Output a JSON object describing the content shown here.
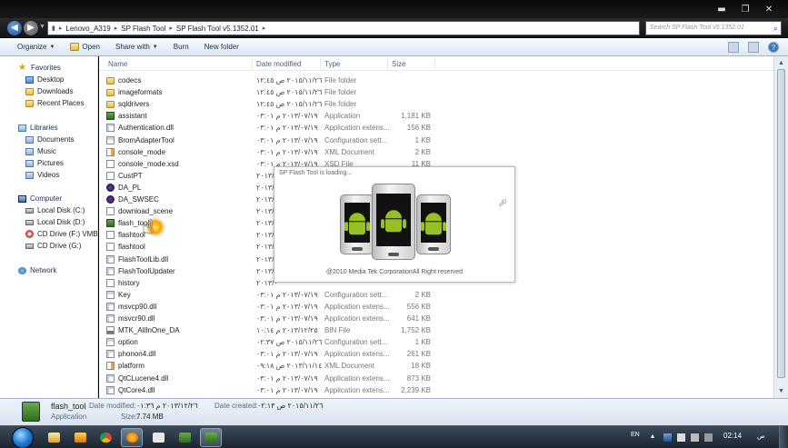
{
  "window": {
    "controls": {
      "minimize": "▬",
      "maximize": "❐",
      "close": "✕"
    }
  },
  "address": {
    "crumbs": [
      "Lenovo_A319",
      "SP Flash Tool",
      "SP Flash Tool v5.1352.01"
    ],
    "search_placeholder": "Search SP Flash Tool v5.1352.01"
  },
  "toolbar": {
    "organize": "Organize",
    "open": "Open",
    "share_with": "Share with",
    "burn": "Burn",
    "new_folder": "New folder"
  },
  "nav": {
    "favorites": {
      "label": "Favorites",
      "items": [
        "Desktop",
        "Downloads",
        "Recent Places"
      ]
    },
    "libraries": {
      "label": "Libraries",
      "items": [
        "Documents",
        "Music",
        "Pictures",
        "Videos"
      ]
    },
    "computer": {
      "label": "Computer",
      "items": [
        "Local Disk (C:)",
        "Local Disk (D:)",
        "CD Drive (F:) VMB Lite",
        "CD Drive (G:)"
      ]
    },
    "network": {
      "label": "Network"
    }
  },
  "columns": {
    "name": "Name",
    "date": "Date modified",
    "type": "Type",
    "size": "Size"
  },
  "files": [
    {
      "name": "codecs",
      "date": "٢٠١٥/١١/٢٦ ص ١٢:٤٥",
      "type": "File folder",
      "size": "",
      "icon": "folder"
    },
    {
      "name": "imageformats",
      "date": "٢٠١٥/١١/٢٦ ص ١٢:٤٥",
      "type": "File folder",
      "size": "",
      "icon": "folder"
    },
    {
      "name": "sqldrivers",
      "date": "٢٠١٥/١١/٢٦ ص ١٢:٤٥",
      "type": "File folder",
      "size": "",
      "icon": "folder"
    },
    {
      "name": "assistant",
      "date": "٢٠١٣/٠٧/١٩ م ٠٣:٠١",
      "type": "Application",
      "size": "1,181 KB",
      "icon": "app"
    },
    {
      "name": "Authentication.dll",
      "date": "٢٠١٣/٠٧/١٩ م ٠٣:٠١",
      "type": "Application extens...",
      "size": "156 KB",
      "icon": "dll"
    },
    {
      "name": "BromAdapterTool",
      "date": "٢٠١٣/٠٧/١٩ م ٠٣:٠١",
      "type": "Configuration sett...",
      "size": "1 KB",
      "icon": "cfg"
    },
    {
      "name": "console_mode",
      "date": "٢٠١٣/٠٧/١٩ م ٠٣:٠١",
      "type": "XML Document",
      "size": "2 KB",
      "icon": "xml"
    },
    {
      "name": "console_mode.xsd",
      "date": "٢٠١٣/٠٧/١٩ م ٠٣:٠١",
      "type": "XSD File",
      "size": "11 KB",
      "icon": "file"
    },
    {
      "name": "CustPT",
      "date": "٢٠١٣/٠",
      "type": "",
      "size": "",
      "icon": "file"
    },
    {
      "name": "DA_PL",
      "date": "٢٠١٣/٠",
      "type": "",
      "size": "",
      "icon": "dapl"
    },
    {
      "name": "DA_SWSEC",
      "date": "٢٠١٣/٠",
      "type": "",
      "size": "",
      "icon": "dapl"
    },
    {
      "name": "download_scene",
      "date": "٢٠١٣/٠",
      "type": "",
      "size": "",
      "icon": "file"
    },
    {
      "name": "flash_tool",
      "date": "٢٠١٣/١",
      "type": "",
      "size": "",
      "icon": "app"
    },
    {
      "name": "flashtool",
      "date": "٢٠١٣/٠",
      "type": "",
      "size": "",
      "icon": "file"
    },
    {
      "name": "flashtool",
      "date": "٢٠١٣/٠",
      "type": "",
      "size": "",
      "icon": "file"
    },
    {
      "name": "FlashToolLib.dll",
      "date": "٢٠١٣/٠",
      "type": "",
      "size": "",
      "icon": "dll"
    },
    {
      "name": "FlashToolUpdater",
      "date": "٢٠١٣/٠",
      "type": "",
      "size": "",
      "icon": "dll"
    },
    {
      "name": "history",
      "date": "٢٠١٣/٠",
      "type": "",
      "size": "",
      "icon": "file"
    },
    {
      "name": "Key",
      "date": "٢٠١٣/٠٧/١٩ م ٠٣:٠١",
      "type": "Configuration sett...",
      "size": "2 KB",
      "icon": "cfg"
    },
    {
      "name": "msvcp90.dll",
      "date": "٢٠١٣/٠٧/١٩ م ٠٣:٠١",
      "type": "Application extens...",
      "size": "556 KB",
      "icon": "dll"
    },
    {
      "name": "msvcr90.dll",
      "date": "٢٠١٣/٠٧/١٩ م ٠٣:٠١",
      "type": "Application extens...",
      "size": "641 KB",
      "icon": "dll"
    },
    {
      "name": "MTK_AllInOne_DA",
      "date": "٢٠١٣/١٢/٢٥ م ١٠:١٤",
      "type": "BIN File",
      "size": "1,752 KB",
      "icon": "bin"
    },
    {
      "name": "option",
      "date": "٢٠١٥/١١/٢٦ ص ٠٢:٣٧",
      "type": "Configuration sett...",
      "size": "1 KB",
      "icon": "cfg"
    },
    {
      "name": "phonon4.dll",
      "date": "٢٠١٣/٠٧/١٩ م ٠٣:٠١",
      "type": "Application extens...",
      "size": "261 KB",
      "icon": "dll"
    },
    {
      "name": "platform",
      "date": "٢٠١٣/١١/١٤ ص ٠٩:١٨",
      "type": "XML Document",
      "size": "18 KB",
      "icon": "xml"
    },
    {
      "name": "QtCLucene4.dll",
      "date": "٢٠١٣/٠٧/١٩ م ٠٣:٠١",
      "type": "Application extens...",
      "size": "873 KB",
      "icon": "dll"
    },
    {
      "name": "QtCore4.dll",
      "date": "٢٠١٣/٠٧/١٩ م ٠٣:٠١",
      "type": "Application extens...",
      "size": "2,239 KB",
      "icon": "dll"
    }
  ],
  "splash": {
    "title": "SP Flash Tool is loading...",
    "copyright": "@2010 Media Tek CorporationAll Right reserved"
  },
  "details": {
    "name": "flash_tool",
    "kind": "Application",
    "modified_label": "Date modified:",
    "modified_value": "٢٠١٣/١٢/٢٦ م ٠١:٣٦",
    "size_label": "Size:",
    "size_value": "7.74 MB",
    "created_label": "Date created:",
    "created_value": "٢٠١٥/١١/٢٦ ص ٠٢:١٣"
  },
  "taskbar": {
    "lang": "EN",
    "time": "02:14",
    "ampm": "ص"
  }
}
